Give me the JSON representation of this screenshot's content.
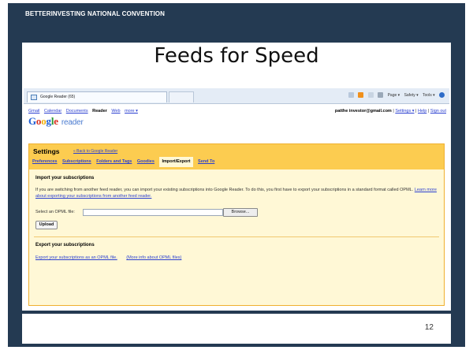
{
  "slide": {
    "header": "BETTERINVESTING NATIONAL CONVENTION",
    "title": "Feeds for Speed",
    "page_number": "12"
  },
  "browser": {
    "tab_title": "Google Reader (65)",
    "toolbar": {
      "page": "Page ▾",
      "safety": "Safety ▾",
      "tools": "Tools ▾"
    }
  },
  "google_nav": {
    "links": [
      "Gmail",
      "Calendar",
      "Documents"
    ],
    "current": "Reader",
    "more_links": [
      "Web",
      "more ▾"
    ],
    "user_email": "patthe investor@gmail.com",
    "settings": "Settings ▾",
    "help": "Help",
    "signout": "Sign out",
    "sep": "|"
  },
  "logo": {
    "word": "Google",
    "product": "reader"
  },
  "settings": {
    "title": "Settings",
    "back_link": "« Back to Google Reader",
    "tabs": [
      "Preferences",
      "Subscriptions",
      "Folders and Tags",
      "Goodies"
    ],
    "active_tab": "Import/Export",
    "last_tab": "Send To"
  },
  "import_section": {
    "title": "Import your subscriptions",
    "para": "If you are switching from another feed reader, you can import your existing subscriptions into Google Reader. To do this, you first have to export your subscriptions in a standard format called OPML.",
    "learn_more": "Learn more about exporting your subscriptions from another feed reader.",
    "file_label": "Select an OPML file:",
    "browse_label": "Browse...",
    "upload_label": "Upload"
  },
  "export_section": {
    "title": "Export your subscriptions",
    "export_link": "Export your subscriptions as an OPML file.",
    "more_info": "(More info about OPML files)"
  }
}
